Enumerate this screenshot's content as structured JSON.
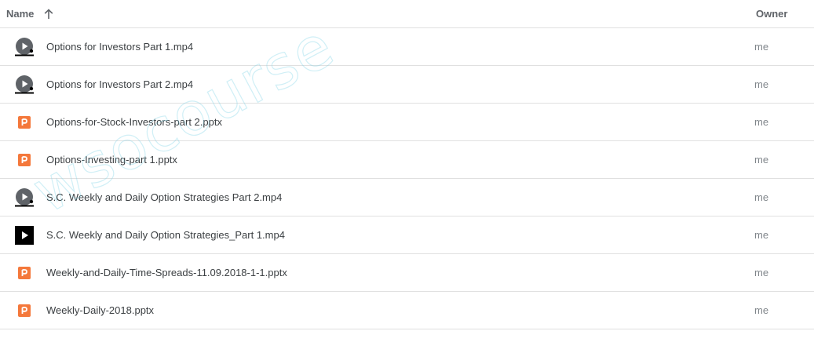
{
  "header": {
    "name_label": "Name",
    "owner_label": "Owner",
    "sort_icon": "arrow-up-icon"
  },
  "files": [
    {
      "name": "Options for Investors Part 1.mp4",
      "owner": "me",
      "icon": "video-grey-icon"
    },
    {
      "name": "Options for Investors Part 2.mp4",
      "owner": "me",
      "icon": "video-grey-icon"
    },
    {
      "name": "Options-for-Stock-Investors-part 2.pptx",
      "owner": "me",
      "icon": "powerpoint-icon"
    },
    {
      "name": "Options-Investing-part 1.pptx",
      "owner": "me",
      "icon": "powerpoint-icon"
    },
    {
      "name": "S.C. Weekly and Daily Option Strategies Part 2.mp4",
      "owner": "me",
      "icon": "video-grey-icon"
    },
    {
      "name": "S.C. Weekly and Daily Option Strategies_Part 1.mp4",
      "owner": "me",
      "icon": "video-black-icon"
    },
    {
      "name": "Weekly-and-Daily-Time-Spreads-11.09.2018-1-1.pptx",
      "owner": "me",
      "icon": "powerpoint-icon"
    },
    {
      "name": "Weekly-Daily-2018.pptx",
      "owner": "me",
      "icon": "powerpoint-icon"
    }
  ],
  "watermark": "wsocourse",
  "colors": {
    "powerpoint": "#f4783b",
    "video_grey": "#5f6368",
    "video_black": "#000000",
    "divider": "#e0e0e0"
  }
}
